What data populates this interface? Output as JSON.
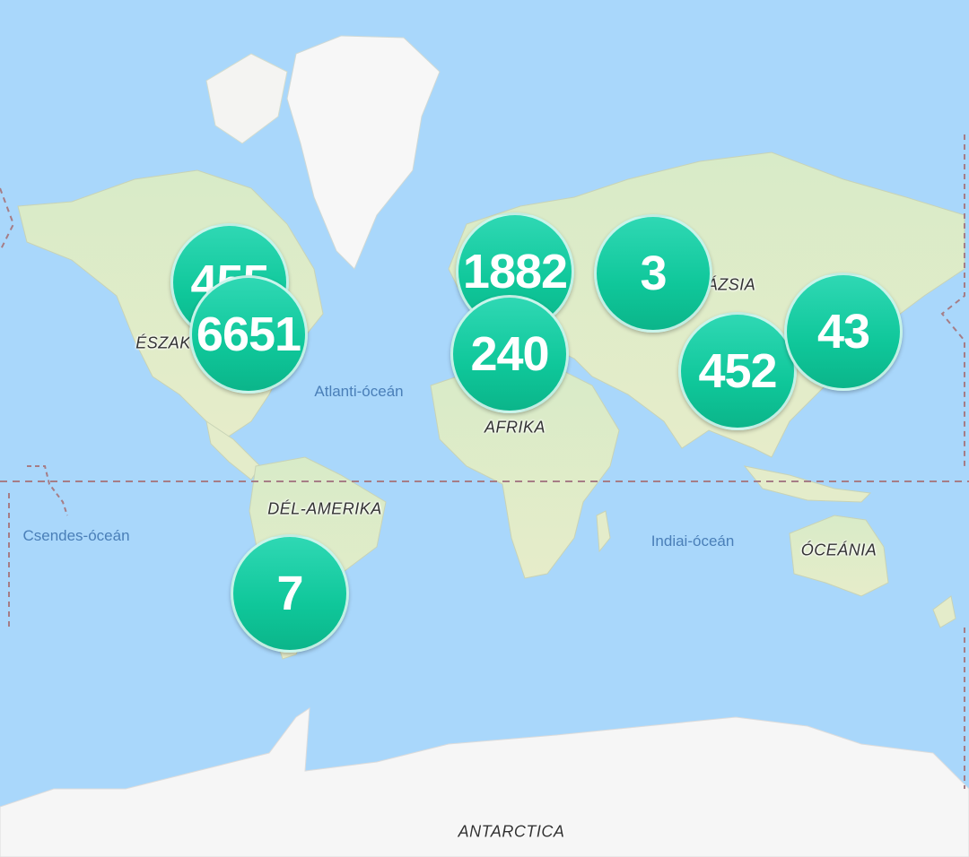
{
  "map": {
    "continent_labels": [
      {
        "id": "north-america",
        "text": "ÉSZAK"
      },
      {
        "id": "south-america",
        "text": "DÉL-AMERIKA"
      },
      {
        "id": "africa",
        "text": "AFRIKA"
      },
      {
        "id": "asia",
        "text": "ÁZSIA"
      },
      {
        "id": "oceania",
        "text": "ÓCEÁNIA"
      },
      {
        "id": "antarctica",
        "text": "ANTARCTICA"
      }
    ],
    "ocean_labels": [
      {
        "id": "atlantic",
        "text": "Atlanti-óceán"
      },
      {
        "id": "pacific",
        "text": "Csendes-óceán"
      },
      {
        "id": "indian",
        "text": "Indiai-óceán"
      }
    ],
    "clusters": [
      {
        "id": "canada",
        "count": "455"
      },
      {
        "id": "usa",
        "count": "6651"
      },
      {
        "id": "europe",
        "count": "1882"
      },
      {
        "id": "north-africa",
        "count": "240"
      },
      {
        "id": "central-asia",
        "count": "3"
      },
      {
        "id": "south-asia",
        "count": "452"
      },
      {
        "id": "east-asia",
        "count": "43"
      },
      {
        "id": "south-america",
        "count": "7"
      }
    ],
    "colors": {
      "water": "#a9d7fb",
      "land": "#dfeccd",
      "ice": "#f7f7f7",
      "cluster": "#10c79b"
    }
  }
}
